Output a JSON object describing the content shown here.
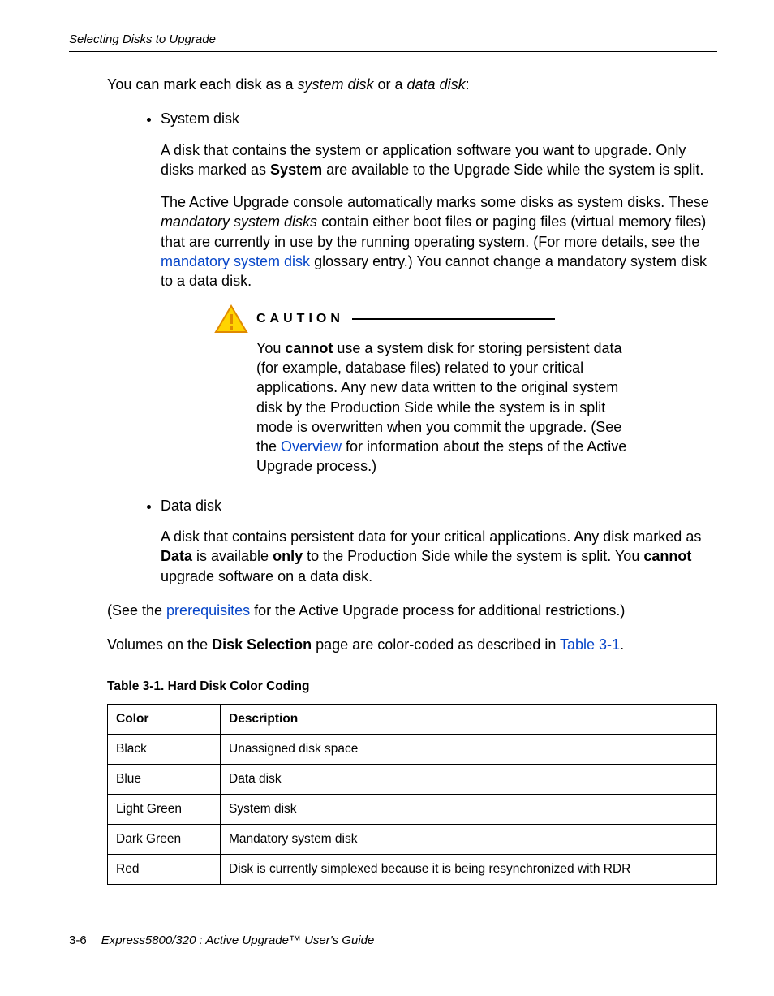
{
  "running_head": "Selecting Disks to Upgrade",
  "intro_parts": {
    "a": "You can mark each disk as a ",
    "b": "system disk",
    "c": " or a ",
    "d": "data disk",
    "e": ":"
  },
  "sys": {
    "label": "System disk",
    "p1": {
      "a": "A disk that contains the system or application software you want to upgrade. Only disks marked as ",
      "b": "System",
      "c": " are available to the Upgrade Side while the system is split."
    },
    "p2": {
      "a": "The Active Upgrade console automatically marks some disks as system disks. These ",
      "b": "mandatory system disks",
      "c": " contain either boot files or paging files (virtual memory files) that are currently in use by the running operating system. (For more details, see the ",
      "d": "mandatory system disk",
      "e": " glossary entry.) You cannot change a mandatory system disk to a data disk."
    }
  },
  "caution": {
    "label": "CAUTION",
    "body": {
      "a": "You ",
      "b": "cannot",
      "c": " use a system disk for storing persistent data (for example, database files) related to your critical applications. Any new data written to the original system disk by the Production Side while the system is in split mode is overwritten when you commit the upgrade. (See the ",
      "d": "Overview",
      "e": " for information about the steps of the Active Upgrade process.)"
    }
  },
  "data": {
    "label": "Data disk",
    "p1": {
      "a": "A disk that contains persistent data for your critical applications. Any disk marked as ",
      "b": "Data",
      "c": " is available ",
      "d": "only",
      "e": " to the Production Side while the system is split. You ",
      "f": "cannot",
      "g": " upgrade software on a data disk."
    }
  },
  "prereq_line": {
    "a": "(See the ",
    "b": "prerequisites",
    "c": " for the Active Upgrade process for additional restrictions.)"
  },
  "volumes_line": {
    "a": "Volumes on the ",
    "b": "Disk Selection",
    "c": " page are color-coded as described in ",
    "d": "Table 3-1",
    "e": "."
  },
  "table": {
    "caption": "Table 3-1. Hard Disk Color Coding",
    "headers": [
      "Color",
      "Description"
    ],
    "rows": [
      [
        "Black",
        "Unassigned disk space"
      ],
      [
        "Blue",
        "Data disk"
      ],
      [
        "Light Green",
        "System disk"
      ],
      [
        "Dark Green",
        "Mandatory system disk"
      ],
      [
        "Red",
        "Disk is currently simplexed because it is being resynchronized with RDR"
      ]
    ]
  },
  "footer": {
    "page": "3-6",
    "title": "Express5800/320   : Active Upgrade™ User's Guide"
  }
}
